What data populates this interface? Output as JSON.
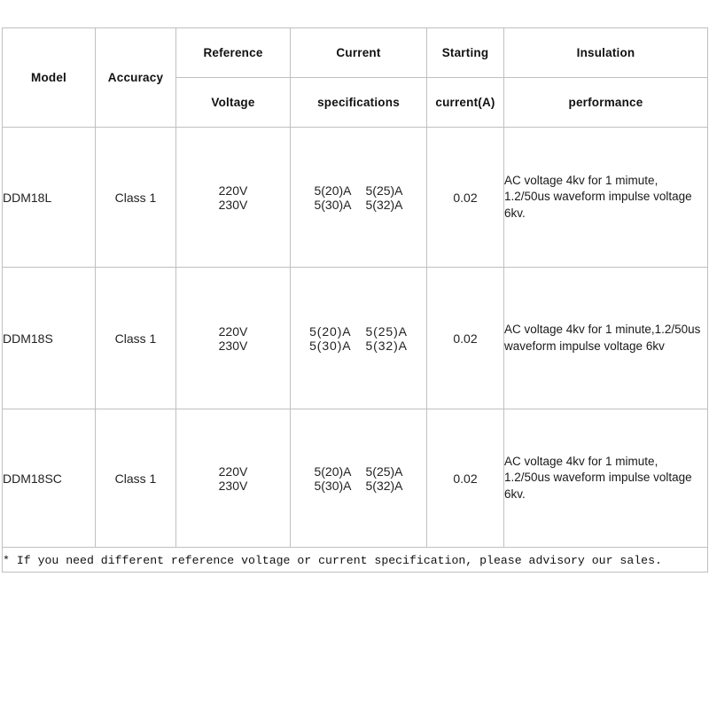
{
  "table": {
    "columns": [
      {
        "key": "model",
        "line1": "Model",
        "line2": ""
      },
      {
        "key": "accuracy",
        "line1": "Accuracy",
        "line2": ""
      },
      {
        "key": "voltage",
        "line1": "Reference",
        "line2": "Voltage"
      },
      {
        "key": "current",
        "line1": "Current",
        "line2": "specifications"
      },
      {
        "key": "starting",
        "line1": "Starting",
        "line2": "current(A)"
      },
      {
        "key": "insulation",
        "line1": "Insulation",
        "line2": "performance"
      }
    ],
    "rows": [
      {
        "model": "DDM18L",
        "accuracy": "Class 1",
        "voltage_1": "220V",
        "voltage_2": "230V",
        "current_1a": "5(20)A",
        "current_1b": "5(25)A",
        "current_2a": "5(30)A",
        "current_2b": "5(32)A",
        "starting_current": "0.02",
        "insulation_line1": "AC voltage 4kv for 1 mimute,",
        "insulation_line2": "1.2/50us waveform impulse voltage 6kv.",
        "insulation_layout": "split"
      },
      {
        "model": "DDM18S",
        "accuracy": "Class 1",
        "voltage_1": "220V",
        "voltage_2": "230V",
        "current_1a": "5(20)A",
        "current_1b": "5(25)A",
        "current_2a": "5(30)A",
        "current_2b": "5(32)A",
        "starting_current": "0.02",
        "insulation_line1": "AC voltage 4kv for 1 minute,1.2/50us  waveform impulse voltage 6kv",
        "insulation_line2": "",
        "insulation_layout": "single"
      },
      {
        "model": "DDM18SC",
        "accuracy": "Class 1",
        "voltage_1": "220V",
        "voltage_2": "230V",
        "current_1a": "5(20)A",
        "current_1b": "5(25)A",
        "current_2a": "5(30)A",
        "current_2b": "5(32)A",
        "starting_current": "0.02",
        "insulation_line1": "AC voltage 4kv for 1 mimute,",
        "insulation_line2": "1.2/50us waveform impulse voltage 6kv.",
        "insulation_layout": "split"
      }
    ],
    "footnote": "*  If you need different  reference voltage or current specification,  please advisory our sales."
  },
  "colors": {
    "border": "#c0c0c0",
    "text": "#1a1a1a",
    "background": "#ffffff"
  }
}
